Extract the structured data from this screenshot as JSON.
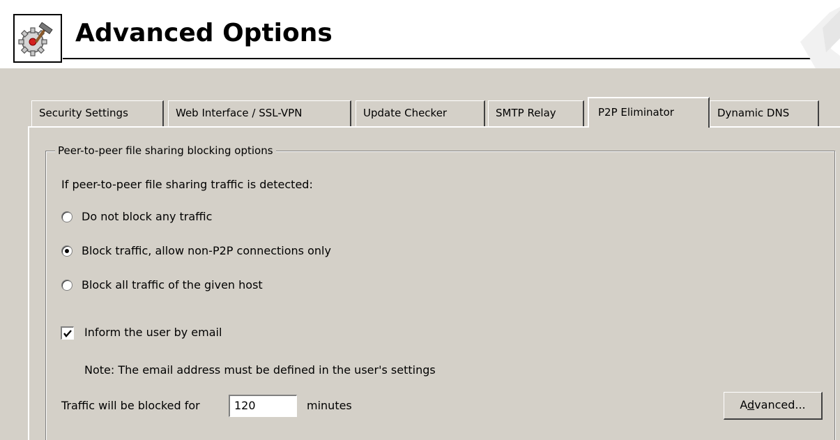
{
  "header": {
    "title": "Advanced Options",
    "icon": "gear-tools-icon"
  },
  "tabs": [
    {
      "label": "Security Settings",
      "active": false
    },
    {
      "label": "Web Interface / SSL-VPN",
      "active": false
    },
    {
      "label": "Update Checker",
      "active": false
    },
    {
      "label": "SMTP Relay",
      "active": false
    },
    {
      "label": "P2P Eliminator",
      "active": true
    },
    {
      "label": "Dynamic DNS",
      "active": false
    }
  ],
  "group": {
    "legend": "Peer-to-peer file sharing blocking options",
    "prompt": "If peer-to-peer file sharing traffic is detected:",
    "options": [
      {
        "label": "Do not block any traffic",
        "selected": false
      },
      {
        "label": "Block traffic, allow non-P2P connections only",
        "selected": true
      },
      {
        "label": "Block all traffic of the given host",
        "selected": false
      }
    ],
    "inform_email": {
      "label": "Inform the user by email",
      "checked": true
    },
    "note": "Note: The email address must be defined in the user's settings",
    "block_duration": {
      "label_before": "Traffic will be blocked for",
      "value": "120",
      "label_after": "minutes"
    },
    "advanced_button": {
      "label_prefix": "A",
      "label_underlined": "d",
      "label_suffix": "vanced..."
    }
  },
  "colors": {
    "dialog_bg": "#d4d0c8",
    "header_bg": "#ffffff",
    "shadow": "#808080",
    "highlight": "#ffffff"
  }
}
